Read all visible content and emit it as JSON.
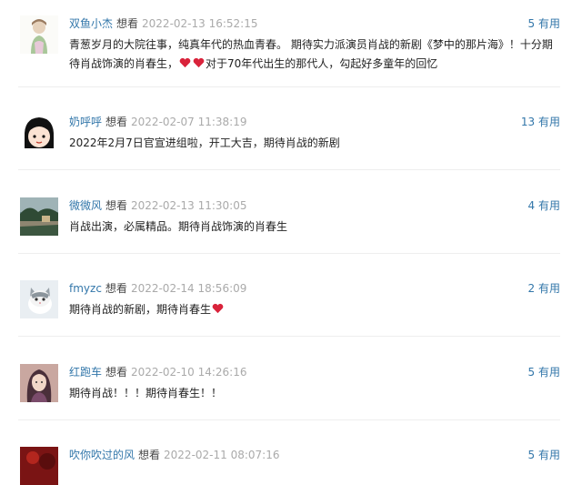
{
  "status_label": "想看",
  "useful_label": "有用",
  "colors": {
    "link": "#3377aa",
    "time": "#aaaaaa",
    "heart": "#d9233b"
  },
  "comments": [
    {
      "user": "双鱼小杰",
      "status": "想看",
      "time": "2022-02-13 16:52:15",
      "votes": "5",
      "useful": "有用",
      "text_a": "青葱岁月的大院往事，纯真年代的热血青春。 期待实力派演员肖战的新剧《梦中的那片海》！十分期待肖战饰演的肖春生，",
      "text_b": "对于70年代出生的那代人，勾起好多童年的回忆",
      "emoji": [
        "heart-icon",
        "heart-icon"
      ],
      "avatar": "avatar-watercolor-girl"
    },
    {
      "user": "奶呼呼",
      "status": "想看",
      "time": "2022-02-07 11:38:19",
      "votes": "13",
      "useful": "有用",
      "text_a": "2022年2月7日官宣进组啦，开工大吉，期待肖战的新剧",
      "avatar": "avatar-cartoon-girl"
    },
    {
      "user": "微微风",
      "status": "想看",
      "time": "2022-02-13 11:30:05",
      "votes": "4",
      "useful": "有用",
      "text_a": "肖战出演，必属精品。期待肖战饰演的肖春生",
      "avatar": "avatar-landscape"
    },
    {
      "user": "fmyzc",
      "status": "想看",
      "time": "2022-02-14 18:56:09",
      "votes": "2",
      "useful": "有用",
      "text_a": "期待肖战的新剧，期待肖春生",
      "emoji": [
        "heart-icon"
      ],
      "avatar": "avatar-cat"
    },
    {
      "user": "红跑车",
      "status": "想看",
      "time": "2022-02-10 14:26:16",
      "votes": "5",
      "useful": "有用",
      "text_a": "期待肖战！！！期待肖春生！！",
      "avatar": "avatar-illustrated-woman"
    },
    {
      "user": "吹你吹过的风",
      "status": "想看",
      "time": "2022-02-11 08:07:16",
      "votes": "5",
      "useful": "有用",
      "text_a": "",
      "avatar": "avatar-red-photo"
    }
  ]
}
